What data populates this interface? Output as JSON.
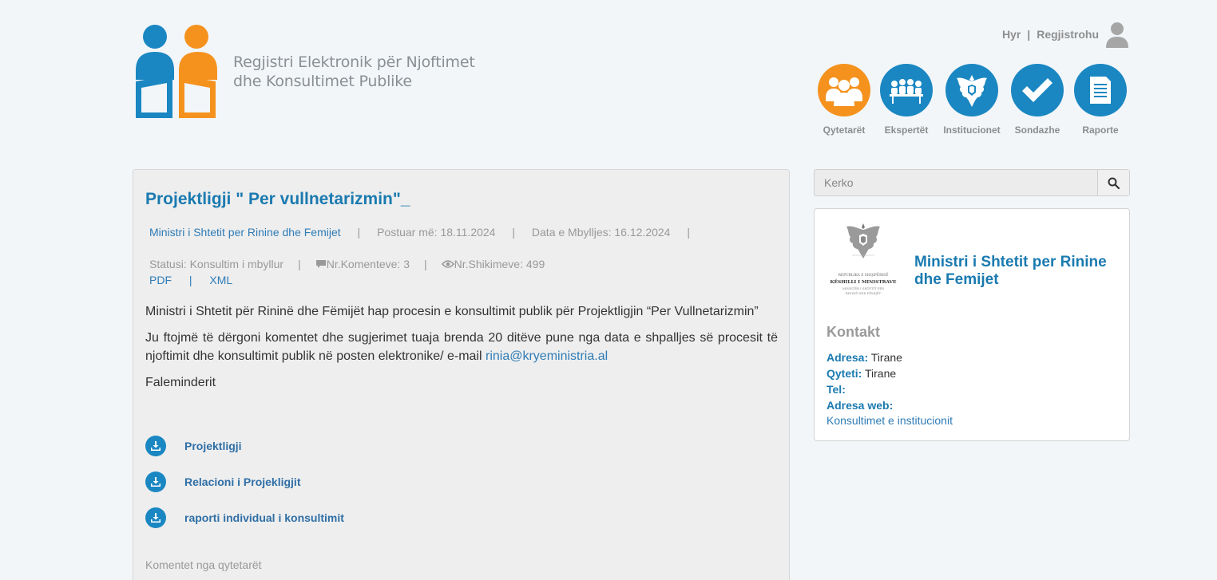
{
  "header": {
    "site_title_line1": "Regjistri Elektronik për Njoftimet",
    "site_title_line2": "dhe Konsultimet Publike",
    "login_label": "Hyr",
    "separator": "|",
    "register_label": "Regjistrohu"
  },
  "nav": {
    "items": [
      {
        "label": "Qytetarët",
        "icon": "citizens-icon",
        "active": true
      },
      {
        "label": "Ekspertët",
        "icon": "experts-icon",
        "active": false
      },
      {
        "label": "Institucionet",
        "icon": "eagle-emblem-icon",
        "active": false
      },
      {
        "label": "Sondazhe",
        "icon": "checkmark-icon",
        "active": false
      },
      {
        "label": "Raporte",
        "icon": "document-icon",
        "active": false
      }
    ]
  },
  "consultation": {
    "title": "Projektligji \" Per vullnetarizmin\"_",
    "institution": "Ministri i Shtetit per Rinine dhe Femijet",
    "separator": "|",
    "posted": "Postuar më: 18.11.2024",
    "closing": "Data e Mbylljes: 16.12.2024",
    "status": "Statusi: Konsultim i mbyllur",
    "comments_count": "Nr.Komenteve: 3",
    "views_count": "Nr.Shikimeve: 499",
    "pdf_label": "PDF",
    "xml_label": "XML",
    "paragraph1": "Ministri i Shtetit për Rininë dhe Fëmijët hap procesin e konsultimit publik për Projektligjin “Per Vullnetarizmin”",
    "paragraph2": "Ju ftojmë të dërgoni komentet dhe sugjerimet tuaja brenda 20 ditëve pune nga data e shpalljes së procesit të njoftimit dhe konsultimit publik në posten elektronike/ e-mail ",
    "email": "rinia@kryeministria.al",
    "paragraph3": "Faleminderit",
    "downloads": [
      {
        "label": "Projektligji"
      },
      {
        "label": "Relacioni i Projekligjit"
      },
      {
        "label": "raporti individual i konsultimit"
      }
    ],
    "comments_heading": "Komentet nga qytetarët"
  },
  "search": {
    "placeholder": "Kerko"
  },
  "institution_card": {
    "emblem_text_line1": "REPUBLIKA E SHQIPËRISË",
    "emblem_text_line2": "KËSHILLI I MINISTRAVE",
    "emblem_text_line3": "MINISTËR I SHTETIT PËR",
    "emblem_text_line4": "RININË DHE FËMIJËT",
    "name": "Ministri i Shtetit per Rinine dhe Femijet",
    "contact_heading": "Kontakt",
    "address_key": "Adresa:",
    "address_value": "Tirane",
    "city_key": "Qyteti:",
    "city_value": "Tirane",
    "tel_key": "Tel:",
    "web_key": "Adresa web:",
    "consultations_link": "Konsultimet e institucionit"
  },
  "colors": {
    "brand_blue": "#1a87c2",
    "brand_orange": "#f5921e",
    "link_blue": "#2f7cb6"
  }
}
